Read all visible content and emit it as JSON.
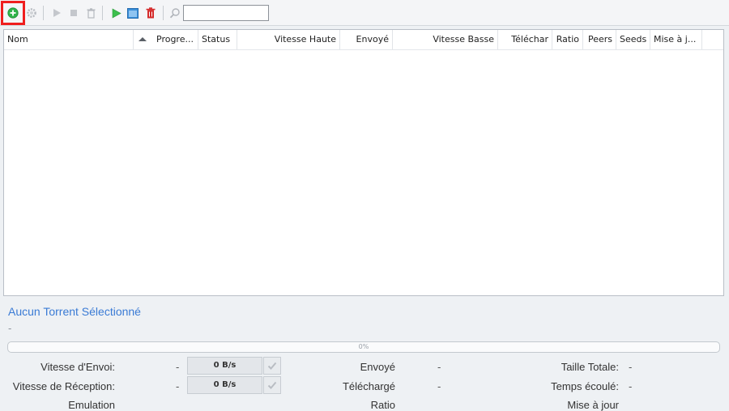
{
  "toolbar": {
    "search_placeholder": "",
    "icons": [
      "add-torrent-icon",
      "settings-gear-icon",
      "play-icon",
      "stop-icon",
      "remove-icon",
      "start-all-icon",
      "window-icon",
      "delete-red-icon",
      "search-icon"
    ]
  },
  "columns": [
    {
      "label": "Nom"
    },
    {
      "label": "Progre..."
    },
    {
      "label": "Status"
    },
    {
      "label": "Vitesse Haute"
    },
    {
      "label": "Envoyé"
    },
    {
      "label": "Vitesse Basse"
    },
    {
      "label": "Téléchar"
    },
    {
      "label": "Ratio"
    },
    {
      "label": "Peers"
    },
    {
      "label": "Seeds"
    },
    {
      "label": "Mise à j..."
    }
  ],
  "details": {
    "title": "Aucun Torrent Sélectionné",
    "subtitle": "-",
    "progress_label": "0%",
    "progress_value": 0,
    "rows": [
      {
        "left_label": "Vitesse d'Envoi:",
        "left_value": "-",
        "rate": "0 B/s",
        "mid_label": "Envoyé",
        "mid_value": "-",
        "right_label": "Taille Totale:",
        "right_value": "-"
      },
      {
        "left_label": "Vitesse de Réception:",
        "left_value": "-",
        "rate": "0 B/s",
        "mid_label": "Téléchargé",
        "mid_value": "-",
        "right_label": "Temps écoulé:",
        "right_value": "-"
      },
      {
        "left_label": "Emulation",
        "mid_label": "Ratio",
        "right_label": "Mise à jour"
      }
    ]
  },
  "colors": {
    "accent": "#3a7bd5",
    "highlight": "#ef1e1e",
    "add_green": "#2fb34a",
    "delete_red": "#d42a2a"
  }
}
